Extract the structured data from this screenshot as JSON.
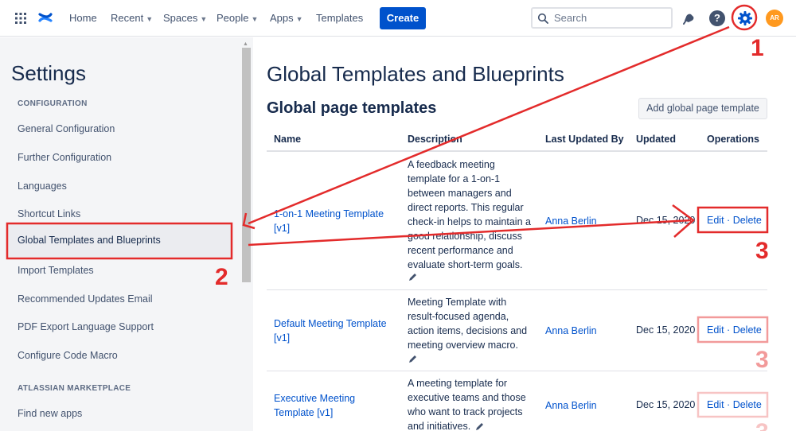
{
  "nav": {
    "home": "Home",
    "recent": "Recent",
    "spaces": "Spaces",
    "people": "People",
    "apps": "Apps",
    "templates": "Templates",
    "create": "Create",
    "search_placeholder": "Search",
    "avatar_initials": "AR",
    "help_glyph": "?"
  },
  "sidebar": {
    "title": "Settings",
    "section_configuration": "CONFIGURATION",
    "section_marketplace": "ATLASSIAN MARKETPLACE",
    "items": [
      {
        "label": "General Configuration"
      },
      {
        "label": "Further Configuration"
      },
      {
        "label": "Languages"
      },
      {
        "label": "Shortcut Links"
      },
      {
        "label": "Global Templates and Blueprints"
      },
      {
        "label": "Import Templates"
      },
      {
        "label": "Recommended Updates Email"
      },
      {
        "label": "PDF Export Language Support"
      },
      {
        "label": "Configure Code Macro"
      }
    ],
    "marketplace_items": [
      {
        "label": "Find new apps"
      }
    ]
  },
  "main": {
    "title": "Global Templates and Blueprints",
    "subtitle": "Global page templates",
    "add_button": "Add global page template",
    "columns": {
      "name": "Name",
      "description": "Description",
      "last_updated_by": "Last Updated By",
      "updated": "Updated",
      "operations": "Operations"
    },
    "rows": [
      {
        "name_line1": "1-on-1 Meeting Template",
        "name_line2": "[v1]",
        "desc": [
          "A feedback meeting",
          "template for a 1-on-1",
          "between managers and",
          "direct reports. This regular",
          "check-in helps to maintain a",
          "good relationship, discuss",
          "recent performance and",
          "evaluate short-term goals."
        ],
        "updated_by": "Anna Berlin",
        "updated": "Dec 15, 2020",
        "edit": "Edit",
        "sep": "·",
        "delete": "Delete"
      },
      {
        "name_line1": "Default Meeting Template",
        "name_line2": "[v1]",
        "desc": [
          "Meeting Template with",
          "result-focused agenda,",
          "action items, decisions and",
          "meeting overview macro."
        ],
        "updated_by": "Anna Berlin",
        "updated": "Dec 15, 2020",
        "edit": "Edit",
        "sep": "·",
        "delete": "Delete"
      },
      {
        "name_line1": "Executive Meeting",
        "name_line2": "Template [v1]",
        "desc": [
          "A meeting template for",
          "executive teams and those",
          "who want to track projects",
          "and initiatives."
        ],
        "updated_by": "Anna Berlin",
        "updated": "Dec 15, 2020",
        "edit": "Edit",
        "sep": "·",
        "delete": "Delete"
      }
    ]
  },
  "annotations": {
    "step1": "1",
    "step2": "2",
    "step3": "3",
    "color": "#e32b2b"
  },
  "colors": {
    "primary": "#0052cc",
    "link": "#0052cc",
    "sidebar_bg": "#f4f5f7"
  }
}
